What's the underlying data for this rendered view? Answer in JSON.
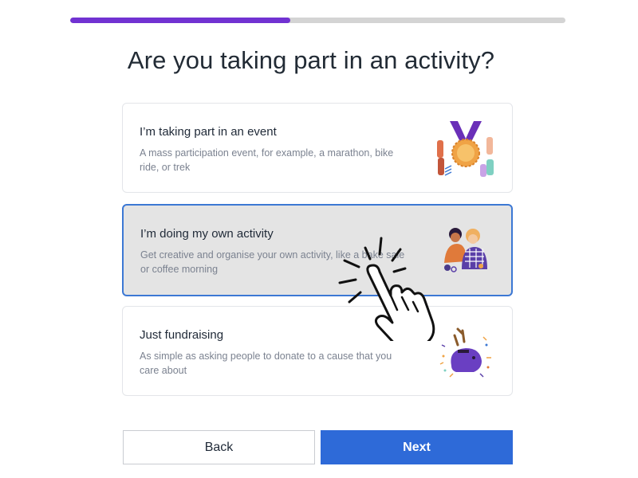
{
  "progress": {
    "value_fraction": 0.445,
    "accent_color": "#7132d2"
  },
  "page": {
    "title": "Are you taking part in an activity?"
  },
  "options": [
    {
      "title": "I’m taking part in an event",
      "description": "A mass participation event, for example, a marathon, bike ride, or trek",
      "illustration": "medal-illustration",
      "selected": false
    },
    {
      "title": "I’m doing my own activity",
      "description": "Get creative and organise your own activity, like a bake sale or coffee morning",
      "illustration": "people-together-illustration",
      "selected": true
    },
    {
      "title": "Just fundraising",
      "description": "As simple as asking people to donate to a cause that you care about",
      "illustration": "piggy-bank-illustration",
      "selected": false
    }
  ],
  "actions": {
    "back_label": "Back",
    "next_label": "Next"
  },
  "colors": {
    "primary": "#2e6ad8",
    "selected_border": "#3c78d4",
    "selected_bg": "#e4e4e4"
  }
}
